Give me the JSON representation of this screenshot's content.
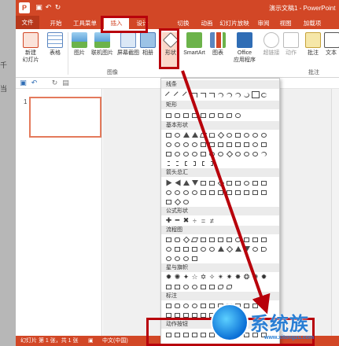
{
  "left_strip": {
    "frag1": "千",
    "frag2": "当"
  },
  "titlebar": {
    "logo": "P",
    "title": "演示文稿1 - PowerPoint"
  },
  "tabs": [
    "文件",
    "开始",
    "工具菜单",
    "插入",
    "设计",
    "切换",
    "动画",
    "幻灯片放映",
    "审阅",
    "视图",
    "加载项"
  ],
  "ribbon": {
    "new_slide": "新建\n幻灯片",
    "table": "表格",
    "picture": "图片",
    "online_picture": "联机图片",
    "screenshot": "屏幕截图",
    "album": "相册",
    "shapes": "形状",
    "smartart": "SmartArt",
    "chart": "图表",
    "office_apps": "Office\n应用程序",
    "hyperlink": "超链接",
    "action": "动作",
    "comment": "批注",
    "textbox": "文本",
    "group_images": "图像",
    "group_comments": "批注"
  },
  "slide_panel": {
    "number": "1"
  },
  "statusbar": {
    "slide_info": "幻灯片 第 1 张，共 1 张",
    "language": "中文(中国)"
  },
  "shapes_menu": {
    "categories": [
      "线条",
      "矩形",
      "基本形状",
      "箭头总汇",
      "公式形状",
      "流程图",
      "星与旗帜",
      "标注",
      "动作按钮"
    ]
  },
  "watermark": {
    "text": "系统族",
    "url": "www.xitongzu.com"
  },
  "colors": {
    "accent": "#d24726",
    "annotation": "#b8000b"
  }
}
